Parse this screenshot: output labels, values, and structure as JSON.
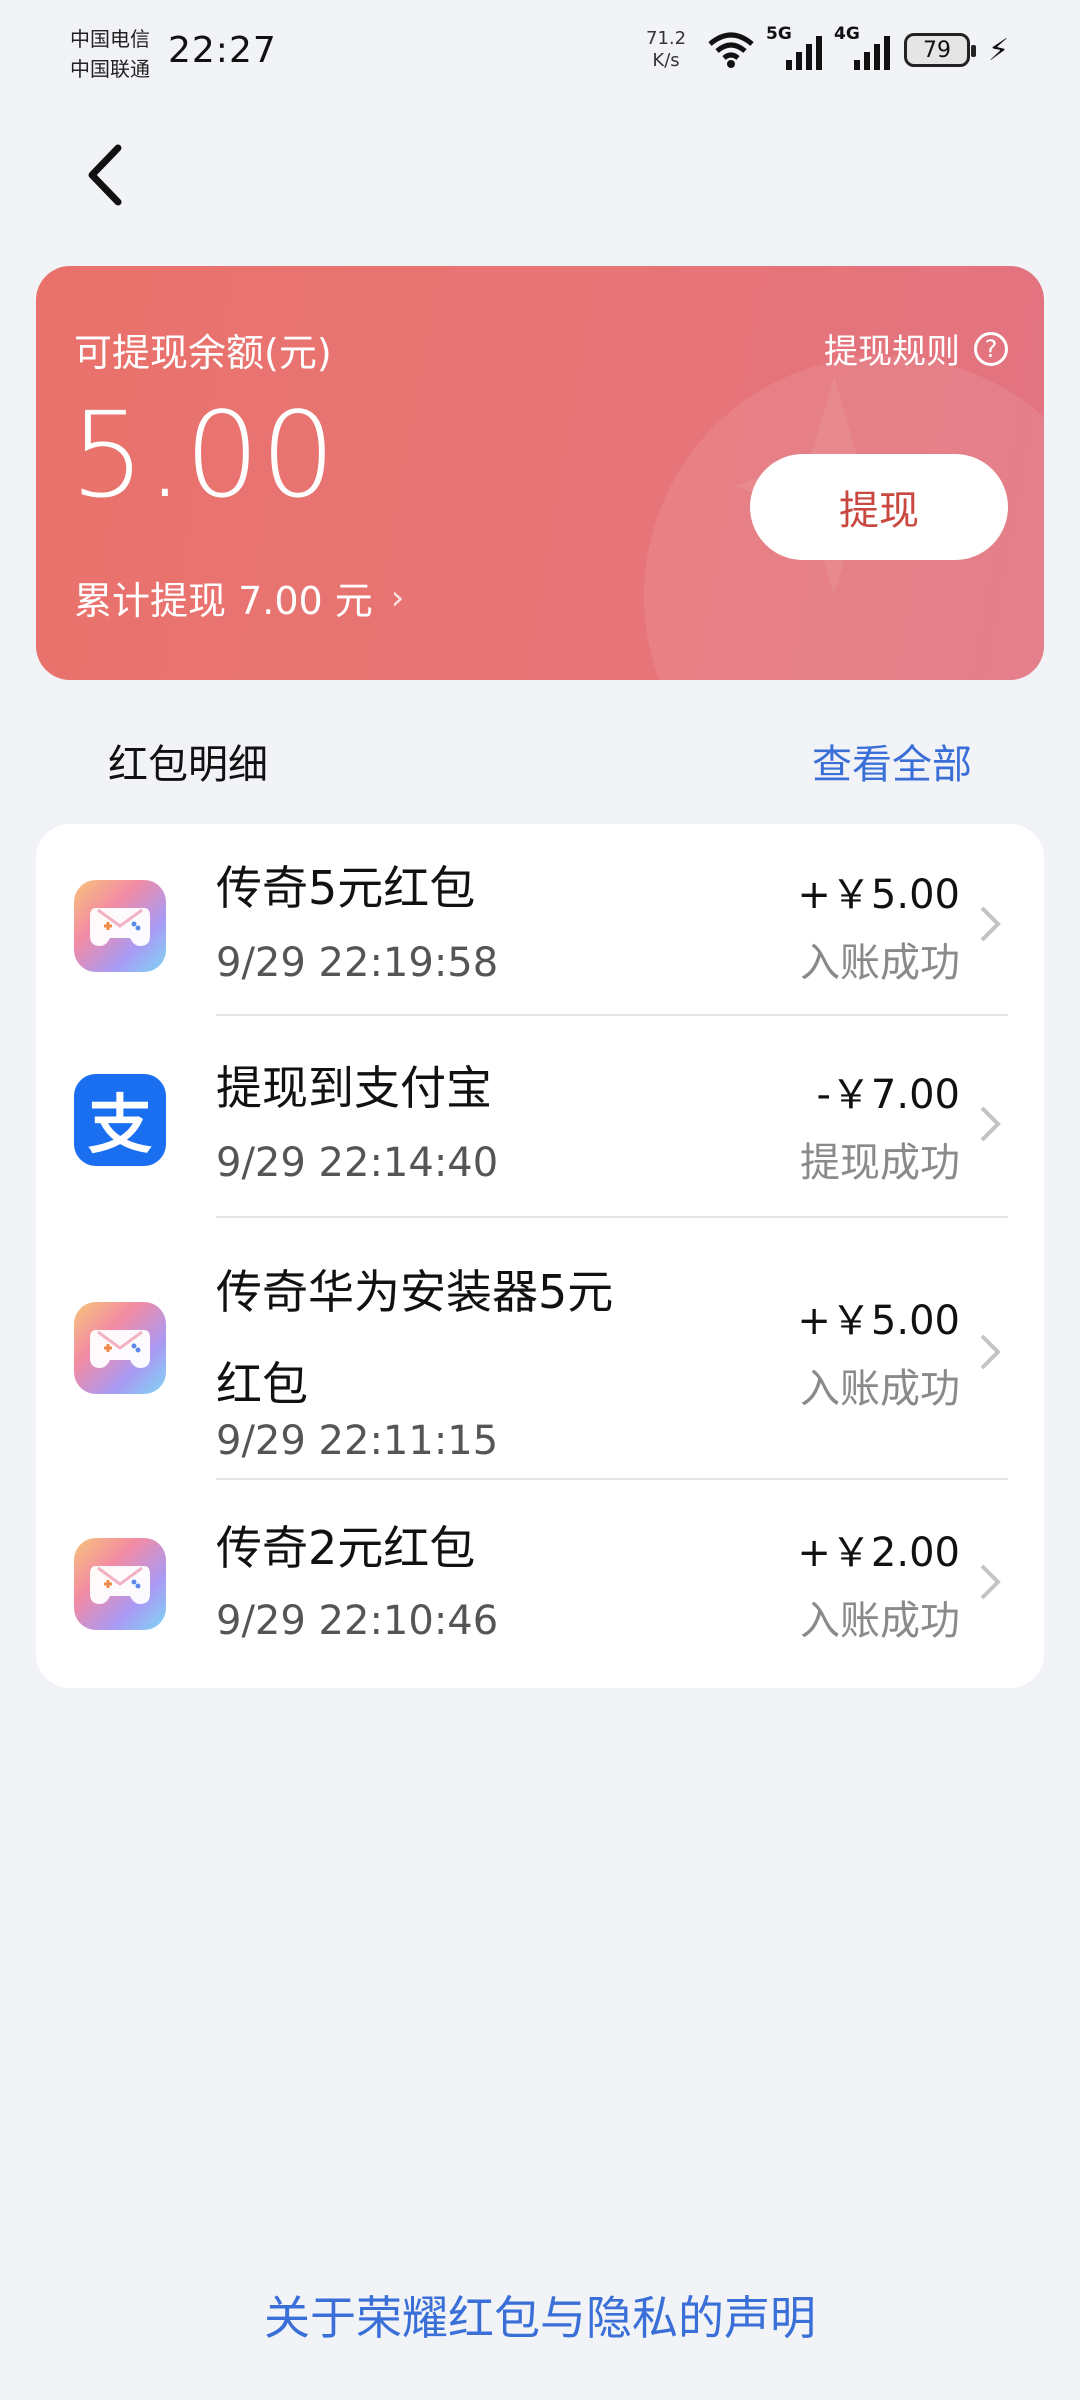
{
  "status_bar": {
    "carrier1": "中国电信",
    "carrier2": "中国联通",
    "time": "22:27",
    "net_speed_value": "71.2",
    "net_speed_unit": "K/s",
    "signal1_label": "5G",
    "signal2_label": "4G",
    "battery": "79"
  },
  "card": {
    "label": "可提现余额(元)",
    "amount": "5.00",
    "total": "累计提现 7.00 元",
    "rules": "提现规则",
    "rules_icon": "?",
    "withdraw_button": "提现",
    "colors": {
      "start": "#e9716b",
      "end": "#e27381",
      "button_text": "#c8473f"
    }
  },
  "section": {
    "title": "红包明细",
    "view_all": "查看全部"
  },
  "transactions": [
    {
      "icon": "game-icon",
      "title": "传奇5元红包",
      "date": "9/29 22:19:58",
      "amount": "+￥5.00",
      "status": "入账成功"
    },
    {
      "icon": "alipay-icon",
      "icon_glyph": "支",
      "title": "提现到支付宝",
      "date": "9/29 22:14:40",
      "amount": "-￥7.00",
      "status": "提现成功"
    },
    {
      "icon": "game-icon",
      "title": "传奇华为安装器5元红包",
      "date": "9/29 22:11:15",
      "amount": "+￥5.00",
      "status": "入账成功"
    },
    {
      "icon": "game-icon",
      "title": "传奇2元红包",
      "date": "9/29 22:10:46",
      "amount": "+￥2.00",
      "status": "入账成功"
    }
  ],
  "footer": "关于荣耀红包与隐私的声明",
  "accent_color": "#3a6fd8"
}
